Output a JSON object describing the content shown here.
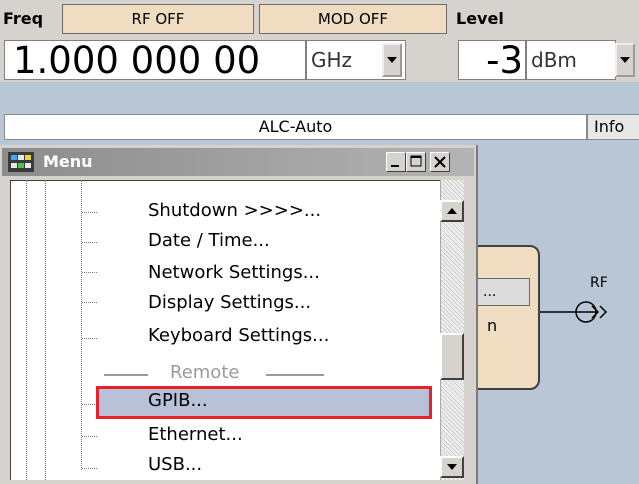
{
  "header": {
    "freq_label": "Freq",
    "rf_status": "RF OFF",
    "mod_status": "MOD OFF",
    "level_label": "Level"
  },
  "display": {
    "frequency_value": "1.000 000 00",
    "frequency_unit": "GHz",
    "level_value": "-3",
    "level_unit": "dBm"
  },
  "alc": {
    "status": "ALC-Auto",
    "info_button": "Info"
  },
  "block_diagram": {
    "button_label": "...",
    "partial_text": "n",
    "rf_output_label": "RF"
  },
  "menu_window": {
    "title": "Menu",
    "items": [
      {
        "label": "Shutdown >>>>..."
      },
      {
        "label": "Date / Time..."
      },
      {
        "label": "Network Settings..."
      },
      {
        "label": "Display Settings..."
      },
      {
        "label": "Keyboard Settings..."
      }
    ],
    "section_label": "Remote",
    "remote_items": [
      {
        "label": "GPIB...",
        "selected": true
      },
      {
        "label": "Ethernet..."
      },
      {
        "label": "USB..."
      }
    ]
  },
  "colors": {
    "status_button_fill": "#f0dcc1",
    "selection_fill": "#b9c1d6",
    "selection_border": "#e8202a",
    "background": "#b9c6d6"
  }
}
